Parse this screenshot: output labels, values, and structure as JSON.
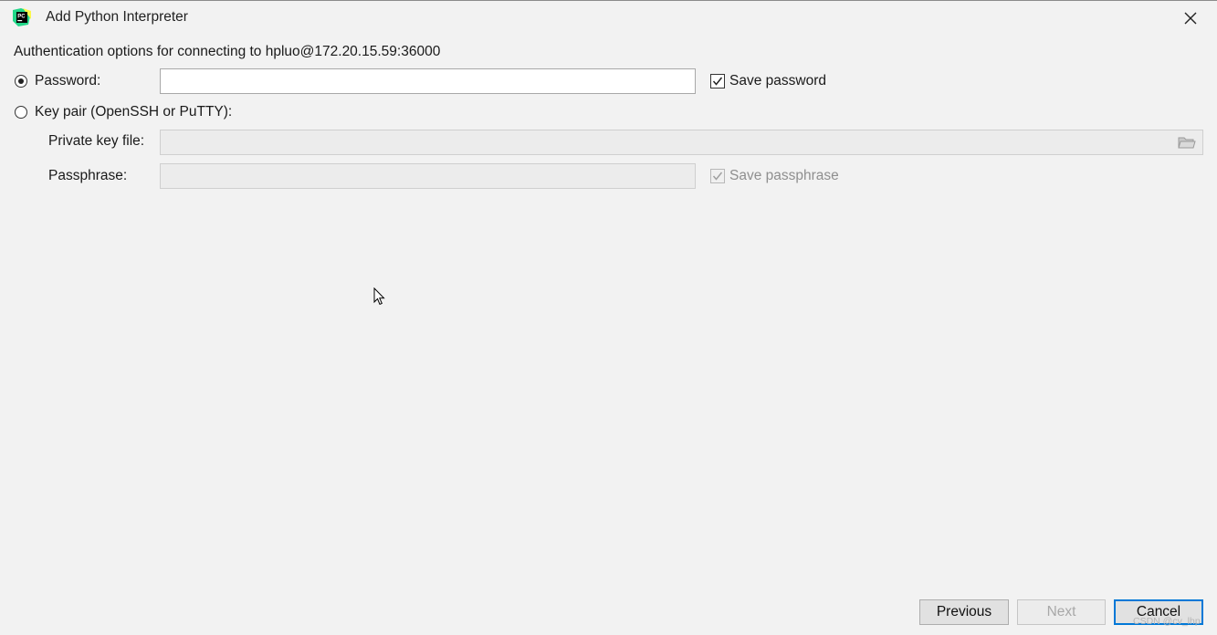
{
  "window": {
    "title": "Add Python Interpreter",
    "app_icon": "pycharm-logo-icon",
    "close_icon": "close-icon"
  },
  "auth": {
    "heading": "Authentication options for connecting to hpluo@172.20.15.59:36000",
    "password_option": {
      "label": "Password:",
      "selected": true
    },
    "password_value": "",
    "save_password": {
      "label": "Save password",
      "checked": true
    },
    "keypair_option": {
      "label": "Key pair (OpenSSH or PuTTY):",
      "selected": false
    },
    "private_key_file": {
      "label": "Private key file:",
      "value": "",
      "enabled": false,
      "browse_icon": "folder-icon"
    },
    "passphrase": {
      "label": "Passphrase:",
      "value": "",
      "enabled": false
    },
    "save_passphrase": {
      "label": "Save passphrase",
      "checked": true,
      "enabled": false
    }
  },
  "buttons": {
    "previous": "Previous",
    "next": "Next",
    "cancel": "Cancel"
  },
  "watermark": "CSDN @cv_lhp",
  "colors": {
    "background": "#f2f2f2",
    "focus_accent": "#0078d7",
    "pycharm_green": "#21d789"
  }
}
